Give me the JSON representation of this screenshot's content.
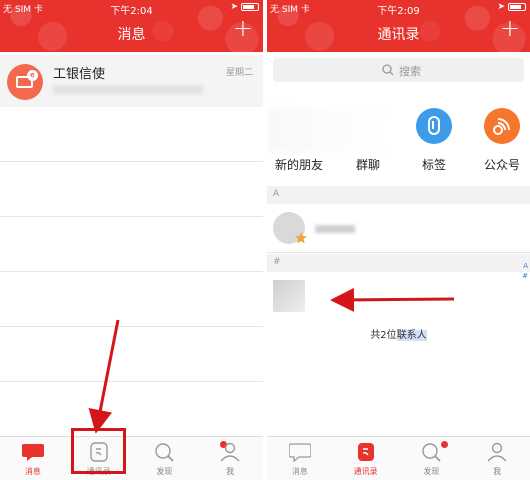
{
  "left": {
    "status": {
      "carrier": "无 SIM 卡",
      "time": "下午2:04"
    },
    "header": {
      "title": "消息",
      "plus": "+"
    },
    "chat": {
      "name": "工银信使",
      "time": "星期二",
      "badge": "e"
    },
    "tabs": [
      {
        "label": "消息",
        "icon": "chat-bubble-icon",
        "active": true
      },
      {
        "label": "通讯录",
        "icon": "contacts-book-icon",
        "active": false
      },
      {
        "label": "发现",
        "icon": "discover-search-icon",
        "active": false
      },
      {
        "label": "我",
        "icon": "person-icon",
        "active": false
      }
    ]
  },
  "right": {
    "status": {
      "carrier": "无 SIM 卡",
      "time": "下午2:09"
    },
    "header": {
      "title": "通讯录",
      "plus": "+"
    },
    "search": {
      "placeholder": "搜索"
    },
    "entries": [
      {
        "label": "新的朋友",
        "icon": "new-friends-icon"
      },
      {
        "label": "群聊",
        "icon": "group-chat-icon"
      },
      {
        "label": "标签",
        "icon": "tag-icon",
        "color": "#3d9be9"
      },
      {
        "label": "公众号",
        "icon": "official-account-icon",
        "color": "#f7762d"
      }
    ],
    "sections": [
      {
        "letter": "A"
      },
      {
        "letter": "#"
      }
    ],
    "total": {
      "prefix": "共2位",
      "highlight": "联系人"
    },
    "index": {
      "a": "A",
      "hash": "#"
    },
    "tabs": [
      {
        "label": "消息",
        "icon": "chat-bubble-icon",
        "active": false
      },
      {
        "label": "通讯录",
        "icon": "contacts-book-icon",
        "active": true
      },
      {
        "label": "发现",
        "icon": "discover-search-icon",
        "active": false
      },
      {
        "label": "我",
        "icon": "person-icon",
        "active": false
      }
    ]
  },
  "colors": {
    "brand_red": "#e8322e",
    "annotation_red": "#d4161a",
    "tag_blue": "#3d9be9",
    "orange": "#f7762d"
  }
}
